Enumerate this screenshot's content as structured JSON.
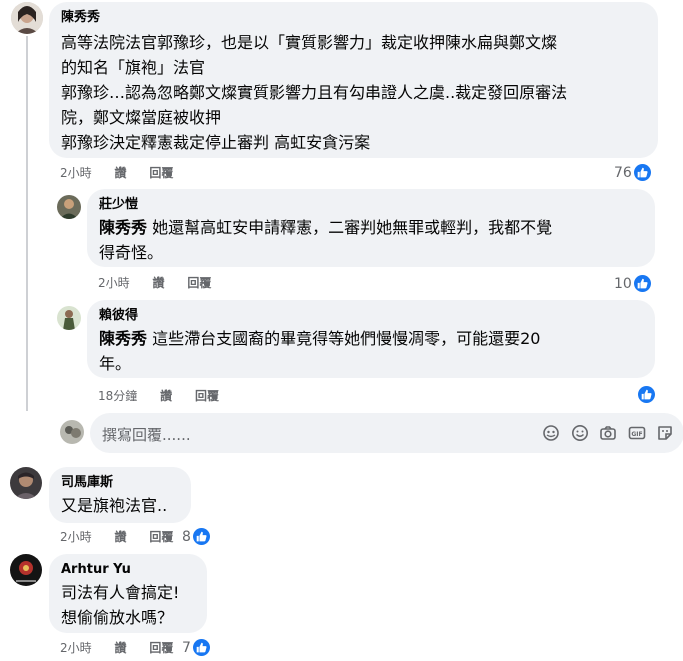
{
  "comments": [
    {
      "author": "陳秀秀",
      "lines": [
        "高等法院法官郭豫珍，也是以「實質影響力」裁定收押陳水扁與鄭文燦",
        "的知名「旗袍」法官",
        "郭豫珍…認為忽略鄭文燦實質影響力且有勾串證人之虞..裁定發回原審法",
        "院，鄭文燦當庭被收押",
        "郭豫珍決定釋憲裁定停止審判 高虹安貪污案"
      ],
      "time": "2小時",
      "like_label": "讚",
      "reply_label": "回覆",
      "reaction_count": "76"
    },
    {
      "author": "莊少愷",
      "mention": "陳秀秀",
      "lines": [
        "她還幫高虹安申請釋憲，二審判她無罪或輕判，我都不覺",
        "得奇怪。"
      ],
      "time": "2小時",
      "like_label": "讚",
      "reply_label": "回覆",
      "reaction_count": "10"
    },
    {
      "author": "賴彼得",
      "mention": "陳秀秀",
      "lines": [
        "這些滯台支國裔的畢竟得等她們慢慢凋零，可能還要20",
        "年。"
      ],
      "time": "18分鐘",
      "like_label": "讚",
      "reply_label": "回覆",
      "reaction_count": ""
    },
    {
      "author": "司馬庫斯",
      "lines": [
        "又是旗袍法官.."
      ],
      "time": "2小時",
      "like_label": "讚",
      "reply_label": "回覆",
      "reaction_count": "8"
    },
    {
      "author": "Arhtur Yu",
      "lines": [
        "司法有人會搞定!",
        "想偷偷放水嗎？"
      ],
      "time": "2小時",
      "like_label": "讚",
      "reply_label": "回覆",
      "reaction_count": "7"
    }
  ],
  "reply_box": {
    "placeholder": "撰寫回覆......",
    "icons": [
      "avatar-sticker-icon",
      "emoji-icon",
      "camera-icon",
      "gif-icon",
      "sticker-icon"
    ]
  },
  "colors": {
    "like_blue": "#1877f2",
    "bubble_bg": "#f0f2f5",
    "secondary_text": "#65676b"
  }
}
